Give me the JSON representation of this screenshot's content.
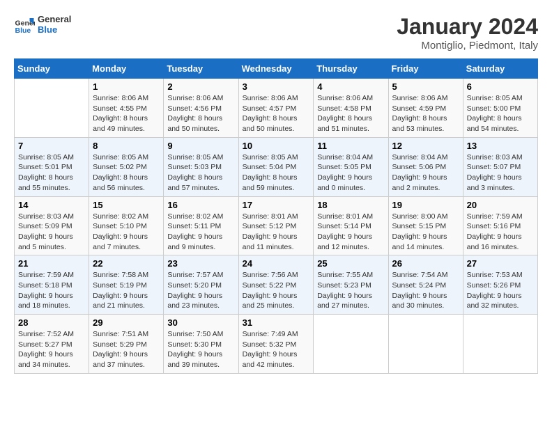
{
  "header": {
    "logo_line1": "General",
    "logo_line2": "Blue",
    "month": "January 2024",
    "location": "Montiglio, Piedmont, Italy"
  },
  "columns": [
    "Sunday",
    "Monday",
    "Tuesday",
    "Wednesday",
    "Thursday",
    "Friday",
    "Saturday"
  ],
  "weeks": [
    [
      {
        "day": "",
        "info": ""
      },
      {
        "day": "1",
        "info": "Sunrise: 8:06 AM\nSunset: 4:55 PM\nDaylight: 8 hours\nand 49 minutes."
      },
      {
        "day": "2",
        "info": "Sunrise: 8:06 AM\nSunset: 4:56 PM\nDaylight: 8 hours\nand 50 minutes."
      },
      {
        "day": "3",
        "info": "Sunrise: 8:06 AM\nSunset: 4:57 PM\nDaylight: 8 hours\nand 50 minutes."
      },
      {
        "day": "4",
        "info": "Sunrise: 8:06 AM\nSunset: 4:58 PM\nDaylight: 8 hours\nand 51 minutes."
      },
      {
        "day": "5",
        "info": "Sunrise: 8:06 AM\nSunset: 4:59 PM\nDaylight: 8 hours\nand 53 minutes."
      },
      {
        "day": "6",
        "info": "Sunrise: 8:05 AM\nSunset: 5:00 PM\nDaylight: 8 hours\nand 54 minutes."
      }
    ],
    [
      {
        "day": "7",
        "info": "Sunrise: 8:05 AM\nSunset: 5:01 PM\nDaylight: 8 hours\nand 55 minutes."
      },
      {
        "day": "8",
        "info": "Sunrise: 8:05 AM\nSunset: 5:02 PM\nDaylight: 8 hours\nand 56 minutes."
      },
      {
        "day": "9",
        "info": "Sunrise: 8:05 AM\nSunset: 5:03 PM\nDaylight: 8 hours\nand 57 minutes."
      },
      {
        "day": "10",
        "info": "Sunrise: 8:05 AM\nSunset: 5:04 PM\nDaylight: 8 hours\nand 59 minutes."
      },
      {
        "day": "11",
        "info": "Sunrise: 8:04 AM\nSunset: 5:05 PM\nDaylight: 9 hours\nand 0 minutes."
      },
      {
        "day": "12",
        "info": "Sunrise: 8:04 AM\nSunset: 5:06 PM\nDaylight: 9 hours\nand 2 minutes."
      },
      {
        "day": "13",
        "info": "Sunrise: 8:03 AM\nSunset: 5:07 PM\nDaylight: 9 hours\nand 3 minutes."
      }
    ],
    [
      {
        "day": "14",
        "info": "Sunrise: 8:03 AM\nSunset: 5:09 PM\nDaylight: 9 hours\nand 5 minutes."
      },
      {
        "day": "15",
        "info": "Sunrise: 8:02 AM\nSunset: 5:10 PM\nDaylight: 9 hours\nand 7 minutes."
      },
      {
        "day": "16",
        "info": "Sunrise: 8:02 AM\nSunset: 5:11 PM\nDaylight: 9 hours\nand 9 minutes."
      },
      {
        "day": "17",
        "info": "Sunrise: 8:01 AM\nSunset: 5:12 PM\nDaylight: 9 hours\nand 11 minutes."
      },
      {
        "day": "18",
        "info": "Sunrise: 8:01 AM\nSunset: 5:14 PM\nDaylight: 9 hours\nand 12 minutes."
      },
      {
        "day": "19",
        "info": "Sunrise: 8:00 AM\nSunset: 5:15 PM\nDaylight: 9 hours\nand 14 minutes."
      },
      {
        "day": "20",
        "info": "Sunrise: 7:59 AM\nSunset: 5:16 PM\nDaylight: 9 hours\nand 16 minutes."
      }
    ],
    [
      {
        "day": "21",
        "info": "Sunrise: 7:59 AM\nSunset: 5:18 PM\nDaylight: 9 hours\nand 18 minutes."
      },
      {
        "day": "22",
        "info": "Sunrise: 7:58 AM\nSunset: 5:19 PM\nDaylight: 9 hours\nand 21 minutes."
      },
      {
        "day": "23",
        "info": "Sunrise: 7:57 AM\nSunset: 5:20 PM\nDaylight: 9 hours\nand 23 minutes."
      },
      {
        "day": "24",
        "info": "Sunrise: 7:56 AM\nSunset: 5:22 PM\nDaylight: 9 hours\nand 25 minutes."
      },
      {
        "day": "25",
        "info": "Sunrise: 7:55 AM\nSunset: 5:23 PM\nDaylight: 9 hours\nand 27 minutes."
      },
      {
        "day": "26",
        "info": "Sunrise: 7:54 AM\nSunset: 5:24 PM\nDaylight: 9 hours\nand 30 minutes."
      },
      {
        "day": "27",
        "info": "Sunrise: 7:53 AM\nSunset: 5:26 PM\nDaylight: 9 hours\nand 32 minutes."
      }
    ],
    [
      {
        "day": "28",
        "info": "Sunrise: 7:52 AM\nSunset: 5:27 PM\nDaylight: 9 hours\nand 34 minutes."
      },
      {
        "day": "29",
        "info": "Sunrise: 7:51 AM\nSunset: 5:29 PM\nDaylight: 9 hours\nand 37 minutes."
      },
      {
        "day": "30",
        "info": "Sunrise: 7:50 AM\nSunset: 5:30 PM\nDaylight: 9 hours\nand 39 minutes."
      },
      {
        "day": "31",
        "info": "Sunrise: 7:49 AM\nSunset: 5:32 PM\nDaylight: 9 hours\nand 42 minutes."
      },
      {
        "day": "",
        "info": ""
      },
      {
        "day": "",
        "info": ""
      },
      {
        "day": "",
        "info": ""
      }
    ]
  ]
}
